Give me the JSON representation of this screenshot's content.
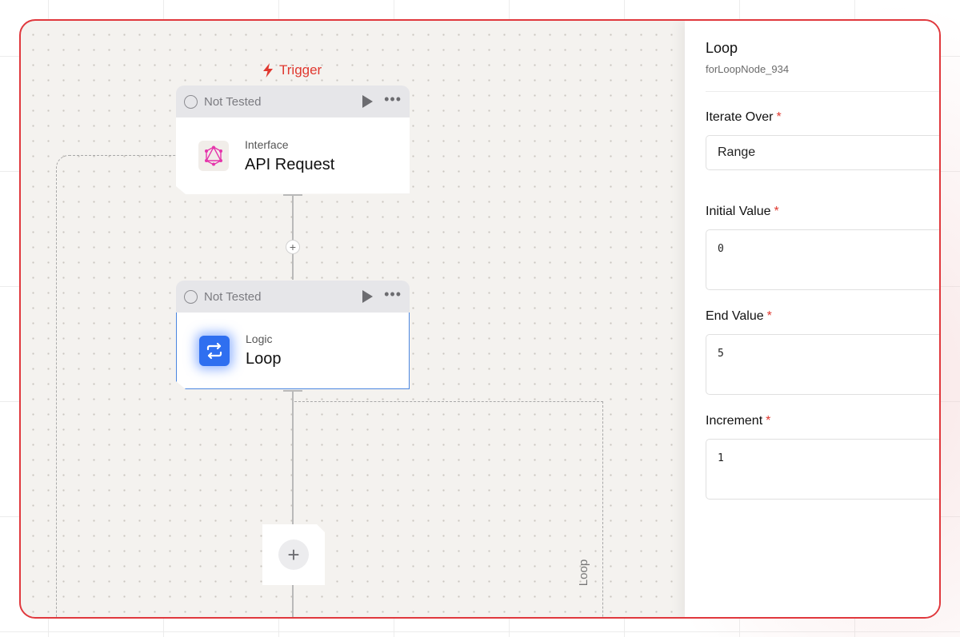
{
  "canvas": {
    "trigger_label": "Trigger",
    "nodes": [
      {
        "status": "Not Tested",
        "kind": "Interface",
        "title": "API Request",
        "icon": "graphql-icon"
      },
      {
        "status": "Not Tested",
        "kind": "Logic",
        "title": "Loop",
        "icon": "loop-icon"
      }
    ],
    "connector_plus": "+",
    "add_step": "+",
    "loop_container_label": "Loop"
  },
  "panel": {
    "title": "Loop",
    "node_id": "forLoopNode_934",
    "fields": [
      {
        "label": "Iterate Over",
        "required": "*",
        "value": "Range"
      },
      {
        "label": "Initial Value",
        "required": "*",
        "value": "0"
      },
      {
        "label": "End Value",
        "required": "*",
        "value": "5"
      },
      {
        "label": "Increment",
        "required": "*",
        "value": "1"
      }
    ]
  },
  "colors": {
    "frame_border": "#e0383d",
    "trigger": "#e0382f",
    "selection": "#4a86e0",
    "loop_icon_bg": "#2f6ff0"
  }
}
